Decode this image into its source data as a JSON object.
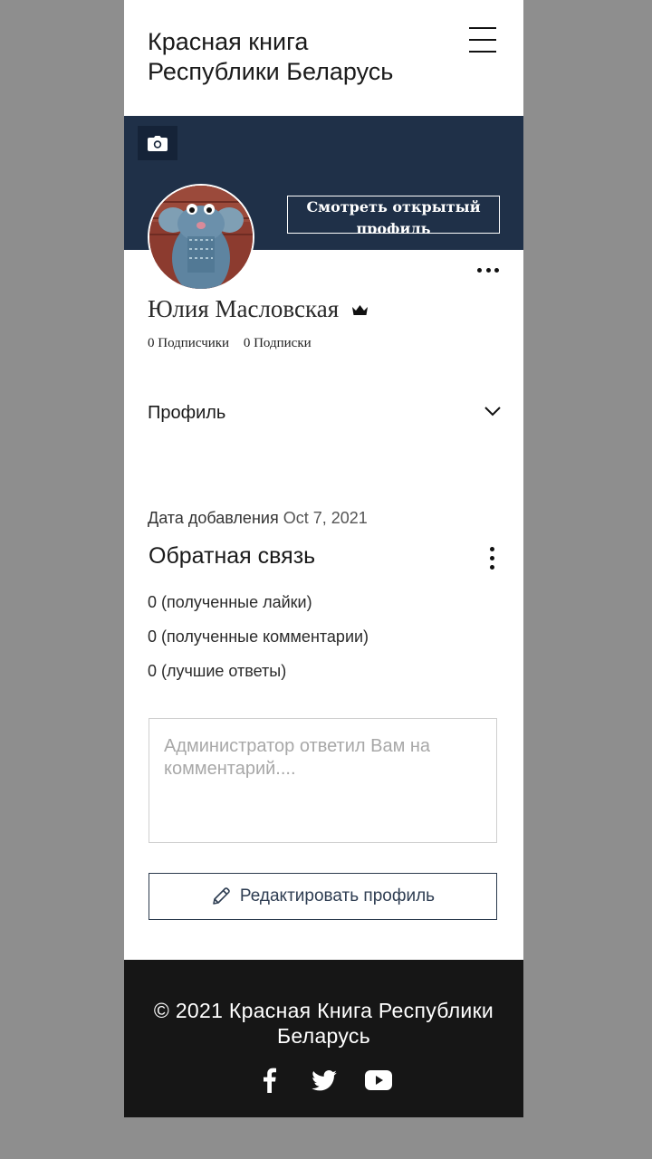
{
  "header": {
    "site_title_line1": "Красная книга",
    "site_title_line2": "Республики Беларусь",
    "menu_icon": "hamburger-menu-icon"
  },
  "cover": {
    "background_color": "#1f3048",
    "camera_icon": "camera-icon",
    "view_profile_label": "Смотреть открытый профиль"
  },
  "profile": {
    "name": "Юлия Масловская",
    "badge_icon": "crown-icon",
    "followers": "0 Подписчики",
    "following": "0 Подписки",
    "more_icon": "more-horizontal-icon"
  },
  "profile_section": {
    "label": "Профиль",
    "toggle_icon": "chevron-down-icon"
  },
  "activity": {
    "added_label": "Дата добавления",
    "added_date": "Oct 7, 2021",
    "feedback_title": "Обратная связь",
    "more_icon": "more-vertical-icon",
    "stats": [
      "0 (полученные лайки)",
      "0 (полученные комментарии)",
      "0 (лучшие ответы)"
    ]
  },
  "comment": {
    "placeholder": "Администратор ответил Вам на комментарий...."
  },
  "edit": {
    "label": "Редактировать профиль",
    "icon": "pencil-icon"
  },
  "footer": {
    "copyright": "© 2021 Красная Книга Республики Беларусь",
    "socials": [
      "facebook-icon",
      "twitter-icon",
      "youtube-icon"
    ]
  },
  "colors": {
    "cover": "#1f3048",
    "footer": "#161616",
    "outer_background": "#8e8e8e"
  }
}
